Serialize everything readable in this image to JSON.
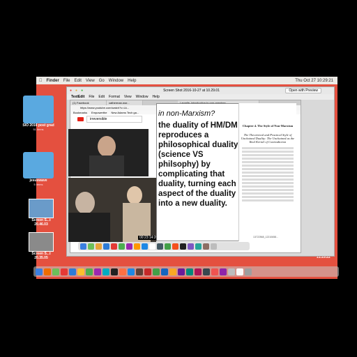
{
  "menubar": {
    "app": "Finder",
    "items": [
      "File",
      "Edit",
      "View",
      "Go",
      "Window",
      "Help"
    ],
    "clock": "Thu Oct 27  10:29:21"
  },
  "desktop_icons": [
    {
      "label": "SIO 2016 post grad",
      "sub": "51 items"
    },
    {
      "label": "jesuswave",
      "sub": "5 items"
    },
    {
      "label": "Screen S...t 20.46.03"
    },
    {
      "label": "Screen S...t 20.35.05"
    }
  ],
  "right_desktop_icons": [
    {
      "label": "Screen S...t 21.29.22"
    }
  ],
  "preview": {
    "title": "Screen Shot 2016-10-27 at 10.29.01",
    "open_button": "Open with Preview",
    "inner_menu": [
      "TextEdit",
      "File",
      "Edit",
      "Format",
      "View",
      "Window",
      "Help"
    ]
  },
  "browser": {
    "tabs": [
      "(1) Facebook",
      "catherman.wor...",
      "Larcelle_introduction to non-marxism"
    ],
    "url": "https://www.youtube.com/watch?v=Lk...",
    "bookmarks": [
      "Bookmarks",
      "Empowerthe",
      "New Adams Tech ga..."
    ],
    "search_value": "irreversible",
    "doc_tab": "... non-marxism.pdf",
    "doc_url": "users/mamm.sc/cover/icords/Downloads/Larcelle/nonMar"
  },
  "highlight": {
    "partial_line": "in non-Marxism?",
    "text": "the duality of HM/DM reproduces a philosophical duality (science VS philsophy) by complicating that duality, turning each aspect of the duality into a new duality."
  },
  "document": {
    "chapter": "Chapter 4. The Style of Non-Marxism",
    "subtitle": "The Theoretical and Practical Style of Unchained Duality: The Unchained as the Real Kernel of Contradiction",
    "page_label": "13722568_12210658..."
  },
  "timestamps": {
    "video": "00:23:14:20"
  },
  "colors": {
    "desktop": "#e4503f",
    "folder": "#5aa9e0",
    "highlight_box": "#ffffff"
  }
}
